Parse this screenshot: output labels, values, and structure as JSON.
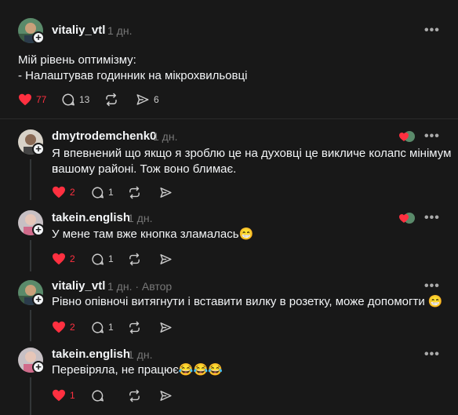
{
  "main_post": {
    "username": "vitaliy_vtl",
    "time": "1 дн.",
    "text_line1": "Мій рівень оптимізму:",
    "text_line2": "- Налаштував годинник на мікрохвильовці",
    "likes": "77",
    "replies": "13",
    "shares": "6"
  },
  "replies": [
    {
      "username": "dmytrodemchenk0",
      "time": "1 дн.",
      "text_line1": "Я впевнений що якщо я зроблю це на духовці це викличе колапс мінімум в",
      "text_line2": "нашому районі. Тож воно блимає.",
      "likes": "2",
      "replies": "1"
    },
    {
      "username": "takein.english",
      "time": "1 дн.",
      "text_line1": "У мене там вже кнопка зламалась😁",
      "likes": "2",
      "replies": "1"
    },
    {
      "username": "vitaliy_vtl",
      "time": "1 дн.",
      "author_tag": "· Автор",
      "text_line1": "Рівно опівночі витягнути і вставити вилку в розетку, може допомогти 😁",
      "likes": "2",
      "replies": "1"
    },
    {
      "username": "takein.english",
      "time": "1 дн.",
      "text_line1": "Перевіряла, не працює😂😂😂",
      "likes": "1"
    }
  ],
  "more_label": "•••",
  "plus_label": "+",
  "colors": {
    "like": "#ff3040",
    "background": "#181818",
    "muted": "#777777"
  }
}
